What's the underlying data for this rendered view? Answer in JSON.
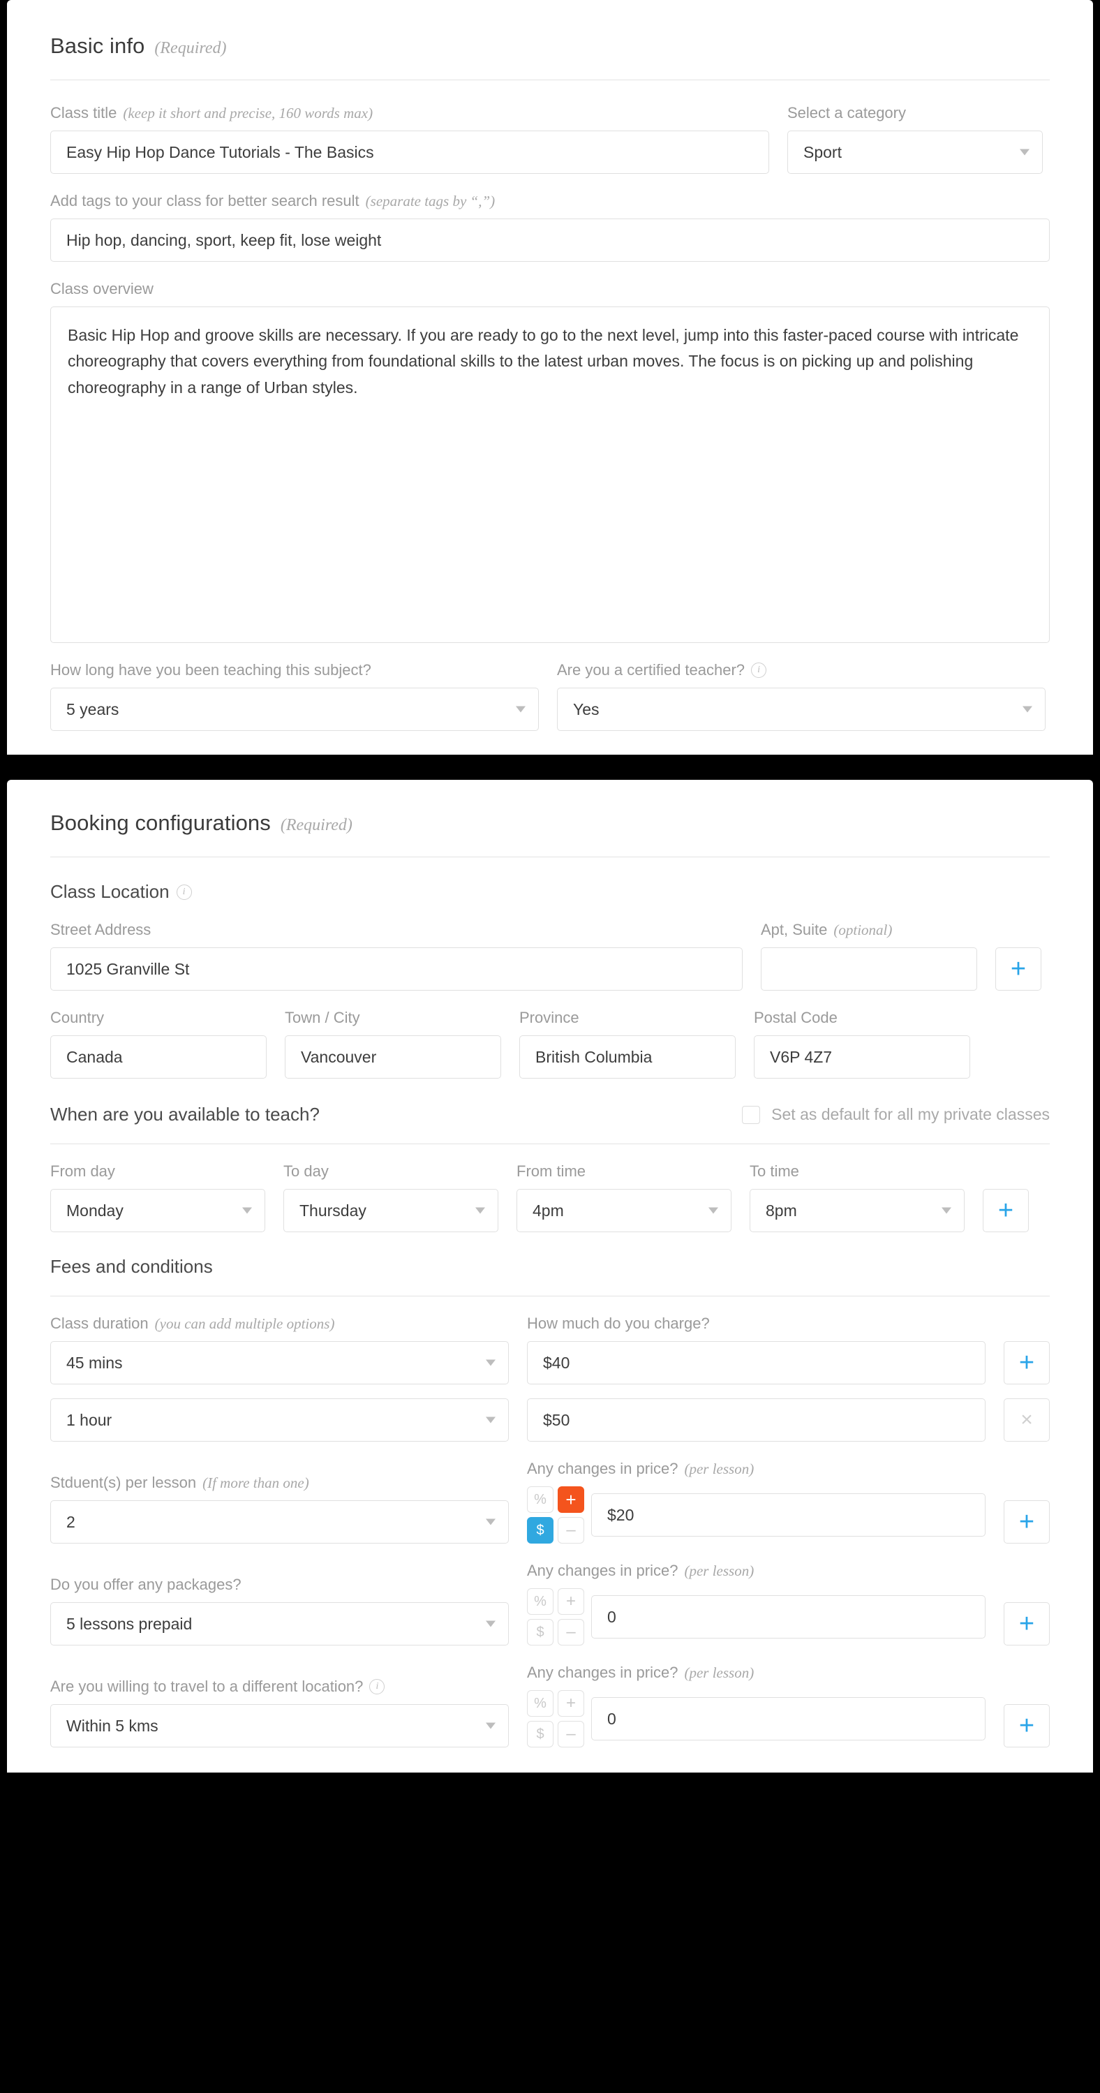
{
  "colors": {
    "accent_blue": "#29a4e8",
    "toggle_blue": "#30a8e0",
    "toggle_orange": "#f4541d",
    "label_gray": "#9a9a9a",
    "border": "#e0e0e0"
  },
  "basic_info": {
    "title": "Basic info",
    "required_note": "(Required)",
    "class_title": {
      "label": "Class title",
      "hint": "(keep it short and precise, 160 words max)",
      "value": "Easy Hip Hop Dance Tutorials - The Basics"
    },
    "category": {
      "label": "Select a category",
      "value": "Sport"
    },
    "tags": {
      "label": "Add tags to your class for better search result",
      "hint": "(separate tags by “,”)",
      "value": "Hip hop, dancing, sport, keep fit, lose weight"
    },
    "overview": {
      "label": "Class overview",
      "value": "Basic Hip Hop and groove skills are necessary. If you are ready to go to the next level, jump into this faster-paced course with intricate choreography that covers everything from foundational skills to the latest urban moves. The focus is on picking up and polishing choreography in a range of Urban styles."
    },
    "teaching_duration": {
      "label": "How long have you been teaching this subject?",
      "value": "5 years"
    },
    "certified": {
      "label": "Are you a certified teacher?",
      "info_icon": "info-icon",
      "value": "Yes"
    }
  },
  "booking": {
    "title": "Booking configurations",
    "required_note": "(Required)",
    "class_location": {
      "title": "Class Location",
      "info_icon": "info-icon",
      "street": {
        "label": "Street Address",
        "value": "1025 Granville St"
      },
      "apt": {
        "label": "Apt, Suite",
        "hint": "(optional)",
        "value": ""
      },
      "add_button": "+",
      "country": {
        "label": "Country",
        "value": "Canada"
      },
      "city": {
        "label": "Town / City",
        "value": "Vancouver"
      },
      "province": {
        "label": "Province",
        "value": "British Columbia"
      },
      "postal": {
        "label": "Postal Code",
        "value": "V6P 4Z7"
      }
    },
    "availability": {
      "title": "When are you available to teach?",
      "default_checkbox_label": "Set as default for all my private classes",
      "default_checkbox_checked": false,
      "from_day": {
        "label": "From day",
        "value": "Monday"
      },
      "to_day": {
        "label": "To day",
        "value": "Thursday"
      },
      "from_time": {
        "label": "From time",
        "value": "4pm"
      },
      "to_time": {
        "label": "To time",
        "value": "8pm"
      },
      "add_button": "+"
    },
    "fees": {
      "title": "Fees and conditions",
      "duration": {
        "label": "Class duration",
        "hint": "(you can add multiple options)",
        "rows": [
          {
            "value": "45 mins",
            "action": "+"
          },
          {
            "value": "1 hour",
            "action": "×"
          }
        ]
      },
      "charge": {
        "label": "How much do you charge?",
        "rows": [
          {
            "value": "$40"
          },
          {
            "value": "$50"
          }
        ]
      },
      "students": {
        "label": "Stduent(s) per lesson",
        "hint": "(If more than one)",
        "value": "2"
      },
      "students_price": {
        "label": "Any changes in price?",
        "hint": "(per lesson)",
        "value": "$20",
        "toggles": {
          "percent": {
            "label": "%",
            "active": false
          },
          "plus": {
            "label": "+",
            "active": true
          },
          "dollar": {
            "label": "$",
            "active": true
          },
          "minus": {
            "label": "–",
            "active": false
          }
        },
        "add_button": "+"
      },
      "packages": {
        "label": "Do you offer any packages?",
        "value": "5 lessons prepaid"
      },
      "packages_price": {
        "label": "Any changes in price?",
        "hint": "(per lesson)",
        "value": "0",
        "toggles": {
          "percent": {
            "label": "%",
            "active": false
          },
          "plus": {
            "label": "+",
            "active": false
          },
          "dollar": {
            "label": "$",
            "active": false
          },
          "minus": {
            "label": "–",
            "active": false
          }
        },
        "add_button": "+"
      },
      "travel": {
        "label": "Are you willing to travel to a different location?",
        "info_icon": "info-icon",
        "value": "Within 5 kms"
      },
      "travel_price": {
        "label": "Any changes in price?",
        "hint": "(per lesson)",
        "value": "0",
        "toggles": {
          "percent": {
            "label": "%",
            "active": false
          },
          "plus": {
            "label": "+",
            "active": false
          },
          "dollar": {
            "label": "$",
            "active": false
          },
          "minus": {
            "label": "–",
            "active": false
          }
        },
        "add_button": "+"
      }
    }
  }
}
